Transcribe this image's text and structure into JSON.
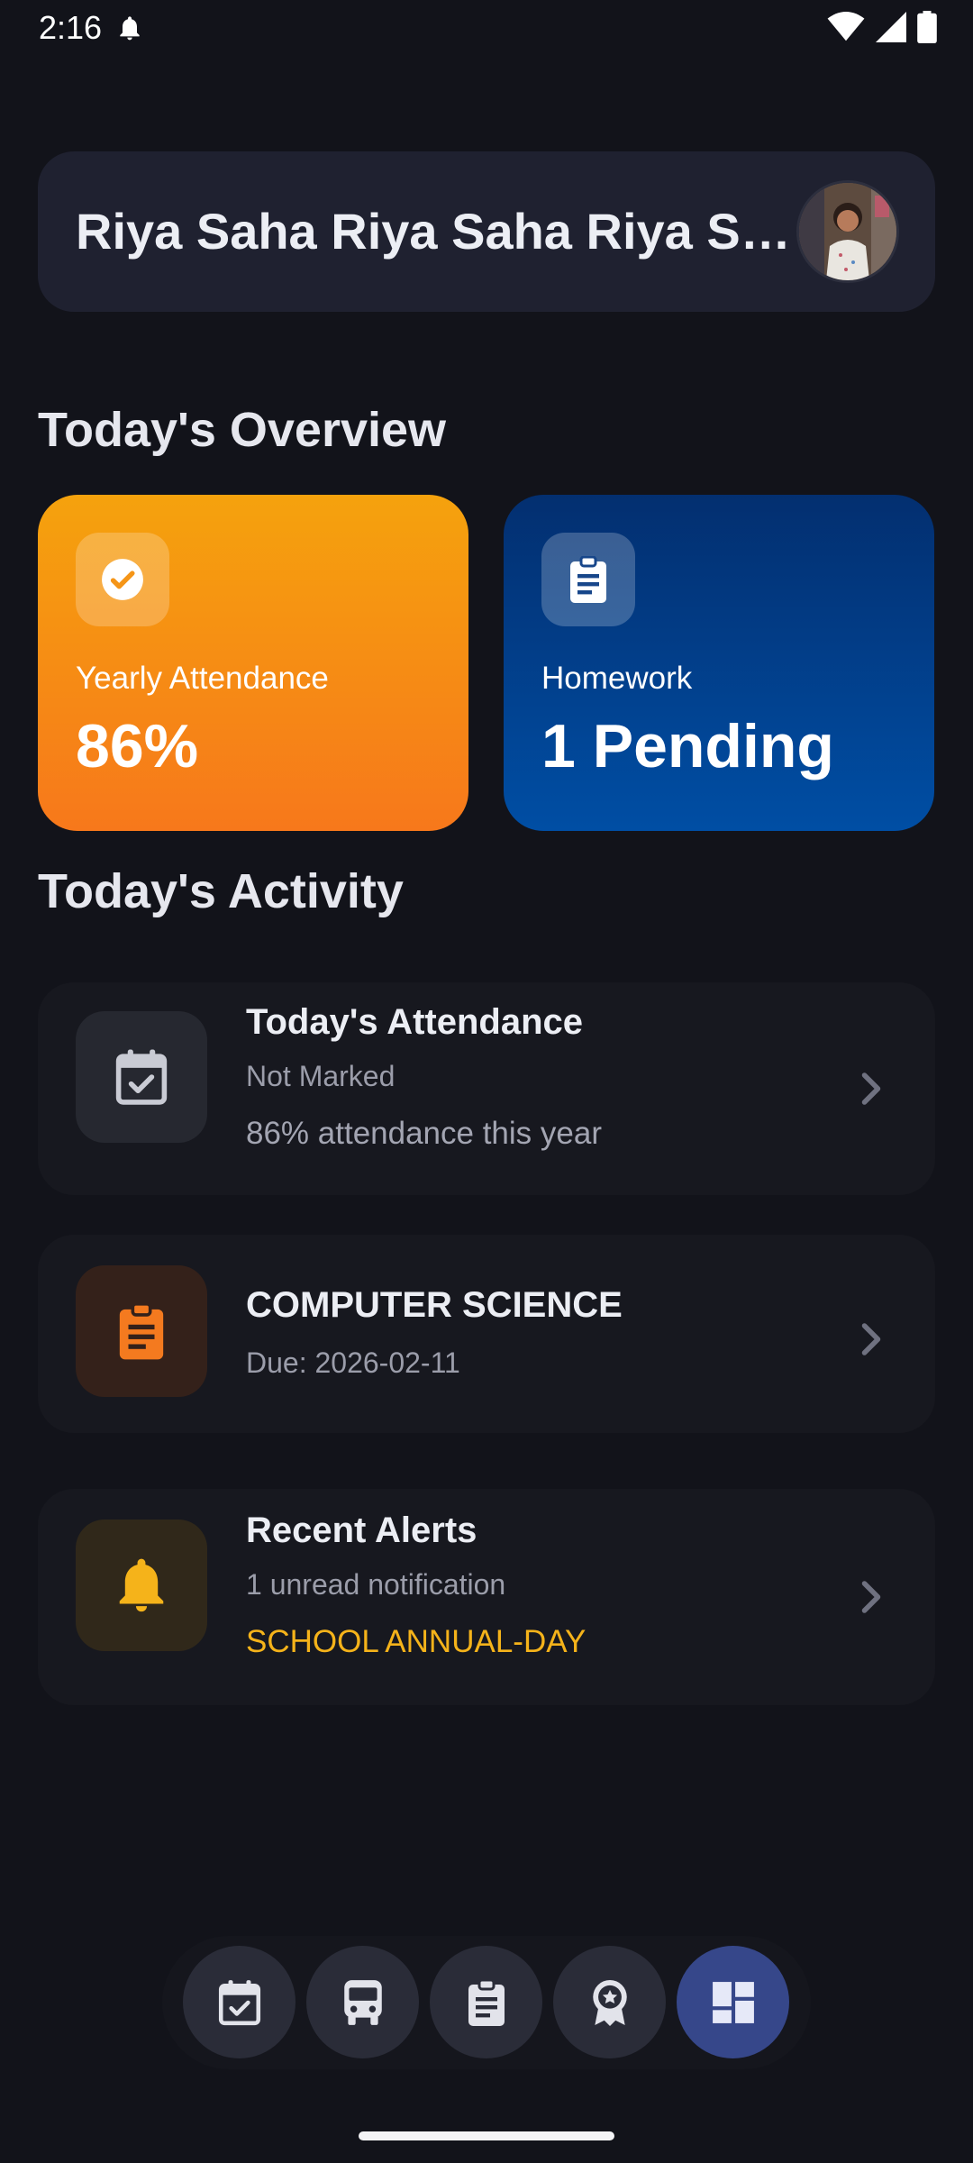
{
  "status_bar": {
    "time": "2:16",
    "icons": [
      "notification-bell-icon",
      "wifi-icon",
      "signal-icon",
      "battery-icon"
    ]
  },
  "header": {
    "student_name": "Riya Saha Riya Saha Riya Saha",
    "avatar": "student-avatar-photo"
  },
  "overview": {
    "title": "Today's Overview",
    "attendance": {
      "label": "Yearly Attendance",
      "value": "86%",
      "icon": "check-circle-icon",
      "color_start": "#f5a20d",
      "color_end": "#f7781b"
    },
    "homework": {
      "label": "Homework",
      "value": "1 Pending",
      "icon": "clipboard-icon",
      "color_start": "#032f70",
      "color_end": "#004ea4"
    }
  },
  "activity": {
    "title": "Today's Activity",
    "items": [
      {
        "title": "Today's Attendance",
        "subtitle": "Not Marked",
        "extra": "86% attendance this year",
        "icon": "calendar-check-icon",
        "accent": "#c9cbd4"
      },
      {
        "title": "COMPUTER SCIENCE",
        "subtitle": "Due: 2026-02-11",
        "icon": "clipboard-icon",
        "accent": "#f47a1f"
      },
      {
        "title": "Recent Alerts",
        "subtitle": "1 unread notification",
        "extra": "SCHOOL ANNUAL-DAY",
        "icon": "bell-icon",
        "accent": "#f5b31a"
      }
    ]
  },
  "bottom_nav": {
    "items": [
      "calendar-check-icon",
      "bus-icon",
      "clipboard-icon",
      "award-badge-icon",
      "dashboard-icon"
    ],
    "active": "dashboard-icon",
    "active_color": "#36478a"
  }
}
